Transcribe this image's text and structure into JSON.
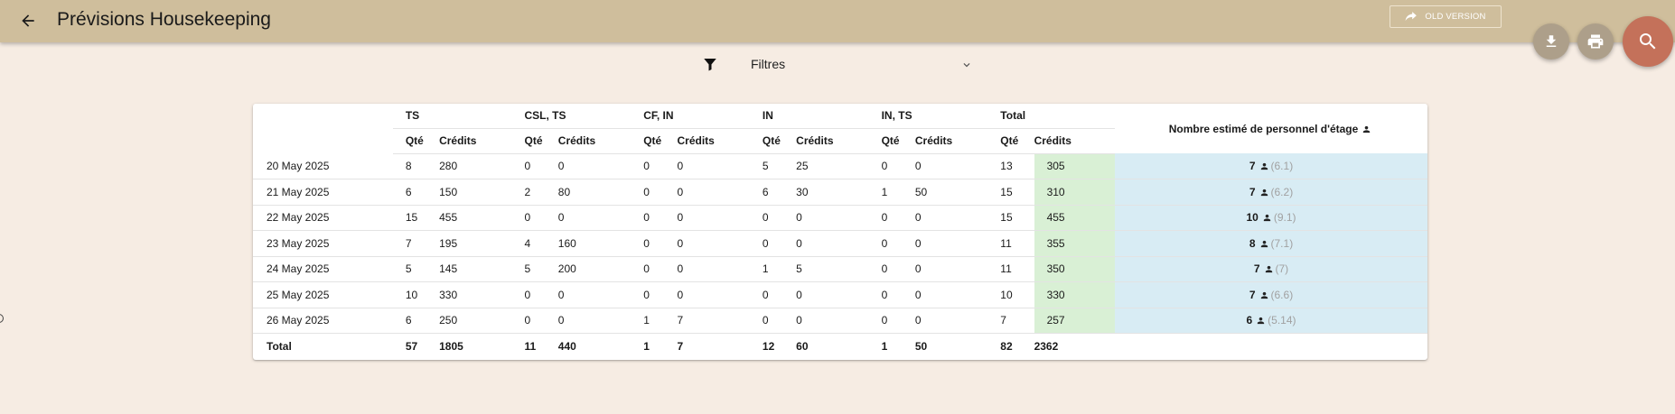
{
  "header": {
    "title": "Prévisions Housekeeping",
    "old_version_label": "OLD VERSION"
  },
  "filters": {
    "label": "Filtres"
  },
  "table": {
    "groups": [
      "TS",
      "CSL, TS",
      "CF, IN",
      "IN",
      "IN, TS",
      "Total"
    ],
    "sub_qty": "Qté",
    "sub_credits": "Crédits",
    "staff_header": "Nombre estimé de personnel d'étage",
    "rows": [
      {
        "date": "20 May 2025",
        "cells": [
          "8",
          "280",
          "0",
          "0",
          "0",
          "0",
          "5",
          "25",
          "0",
          "0",
          "13",
          "305"
        ],
        "staff": "7",
        "staff_exact": "(6.1)"
      },
      {
        "date": "21 May 2025",
        "cells": [
          "6",
          "150",
          "2",
          "80",
          "0",
          "0",
          "6",
          "30",
          "1",
          "50",
          "15",
          "310"
        ],
        "staff": "7",
        "staff_exact": "(6.2)"
      },
      {
        "date": "22 May 2025",
        "cells": [
          "15",
          "455",
          "0",
          "0",
          "0",
          "0",
          "0",
          "0",
          "0",
          "0",
          "15",
          "455"
        ],
        "staff": "10",
        "staff_exact": "(9.1)"
      },
      {
        "date": "23 May 2025",
        "cells": [
          "7",
          "195",
          "4",
          "160",
          "0",
          "0",
          "0",
          "0",
          "0",
          "0",
          "11",
          "355"
        ],
        "staff": "8",
        "staff_exact": "(7.1)"
      },
      {
        "date": "24 May 2025",
        "cells": [
          "5",
          "145",
          "5",
          "200",
          "0",
          "0",
          "1",
          "5",
          "0",
          "0",
          "11",
          "350"
        ],
        "staff": "7",
        "staff_exact": "(7)"
      },
      {
        "date": "25 May 2025",
        "cells": [
          "10",
          "330",
          "0",
          "0",
          "0",
          "0",
          "0",
          "0",
          "0",
          "0",
          "10",
          "330"
        ],
        "staff": "7",
        "staff_exact": "(6.6)"
      },
      {
        "date": "26 May 2025",
        "cells": [
          "6",
          "250",
          "0",
          "0",
          "1",
          "7",
          "0",
          "0",
          "0",
          "0",
          "7",
          "257"
        ],
        "staff": "6",
        "staff_exact": "(5.14)"
      }
    ],
    "total": {
      "label": "Total",
      "cells": [
        "57",
        "1805",
        "11",
        "440",
        "1",
        "7",
        "12",
        "60",
        "1",
        "50",
        "82",
        "2362"
      ]
    }
  },
  "icons": {
    "back": "arrow-left-icon",
    "old_version": "share-arrow-icon",
    "download": "download-icon",
    "print": "print-icon",
    "search": "search-icon",
    "filter": "filter-icon",
    "chevron": "chevron-down-icon",
    "person": "person-icon"
  },
  "colors": {
    "appbar": "#cfbe9c",
    "background": "#f6ece3",
    "total_credits_bg": "#d9f0d5",
    "staff_bg": "#d8ecf4",
    "search_fab": "#c4715a",
    "secondary_fab": "#ad9f8a"
  }
}
